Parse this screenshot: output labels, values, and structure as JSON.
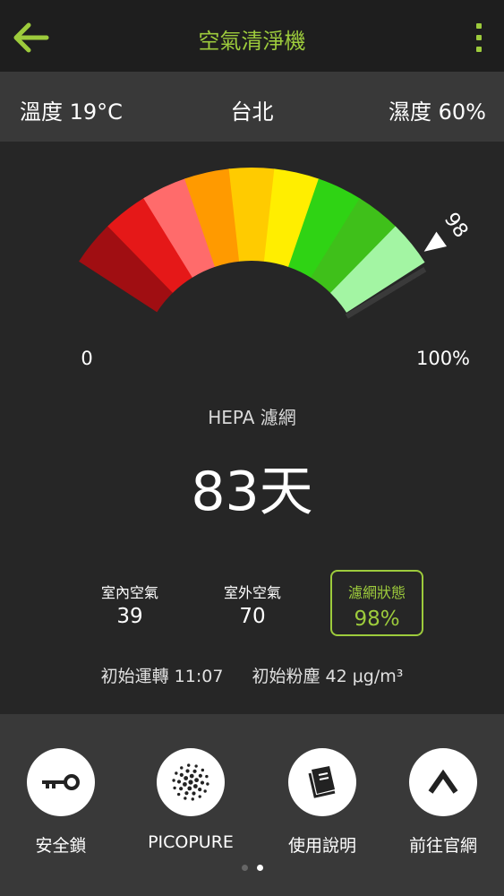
{
  "header": {
    "title": "空氣清淨機",
    "back_icon": "arrow-left-icon",
    "menu_icon": "more-vertical-icon",
    "accent_color": "#9dcb3c"
  },
  "infobar": {
    "temperature": "溫度 19°C",
    "city": "台北",
    "humidity": "濕度 60%"
  },
  "gauge": {
    "min_label": "0",
    "max_label": "100%",
    "pointer_value": 98,
    "pointer_label": "98",
    "segment_colors": [
      "#a00e12",
      "#e51818",
      "#ff6b6b",
      "#ff9a00",
      "#ffcb00",
      "#ffee00",
      "#2fd314",
      "#3fc01a",
      "#a3f5a3"
    ]
  },
  "filter": {
    "label": "HEPA 濾網",
    "days_remaining": "83天"
  },
  "stats": {
    "indoor_label": "室內空氣",
    "indoor_value": "39",
    "outdoor_label": "室外空氣",
    "outdoor_value": "70",
    "filter_label": "濾網狀態",
    "filter_value": "98%"
  },
  "initial": {
    "run": "初始運轉 11:07",
    "dust": "初始粉塵 42 μg/m³"
  },
  "actions": [
    {
      "label": "安全鎖",
      "icon": "key-icon"
    },
    {
      "label": "PICOPURE",
      "icon": "dot-cluster-icon"
    },
    {
      "label": "使用說明",
      "icon": "book-icon"
    },
    {
      "label": "前往官網",
      "icon": "chevron-up-icon"
    }
  ],
  "pager": {
    "current": 2,
    "total": 2
  }
}
